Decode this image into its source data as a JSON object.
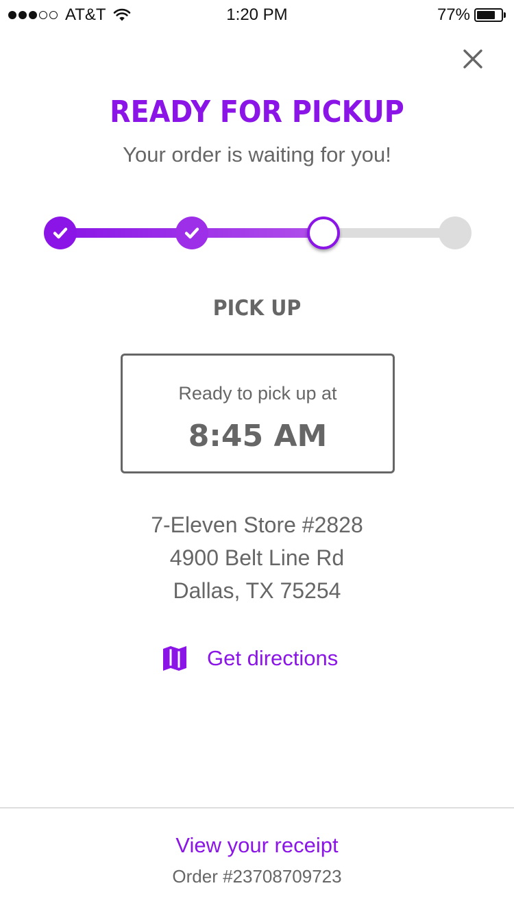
{
  "status_bar": {
    "carrier": "AT&T",
    "time": "1:20 PM",
    "battery_percent": "77%",
    "battery_level": 0.77,
    "signal_bars_filled": 3,
    "signal_bars_total": 5,
    "wifi_icon": "wifi-icon"
  },
  "colors": {
    "accent": "#8a15e6",
    "accent_light": "#b150ea",
    "text_gray": "#666666",
    "track_gray": "#dddddd"
  },
  "header": {
    "close_icon": "close-icon",
    "title": "READY FOR PICKUP",
    "subtitle": "Your order is waiting for you!"
  },
  "progress": {
    "total_steps": 4,
    "completed_steps": 2,
    "current_step": 3,
    "check_icon": "check-icon"
  },
  "pickup": {
    "step_label": "PICK UP",
    "time_caption": "Ready to pick up at",
    "time_value": "8:45 AM"
  },
  "store": {
    "name": "7-Eleven Store #2828",
    "street": "4900 Belt Line Rd",
    "city_state_zip": "Dallas, TX 75254"
  },
  "directions": {
    "icon": "map-icon",
    "label": "Get directions"
  },
  "footer": {
    "receipt_label": "View your receipt",
    "order_number": "Order #23708709723"
  }
}
